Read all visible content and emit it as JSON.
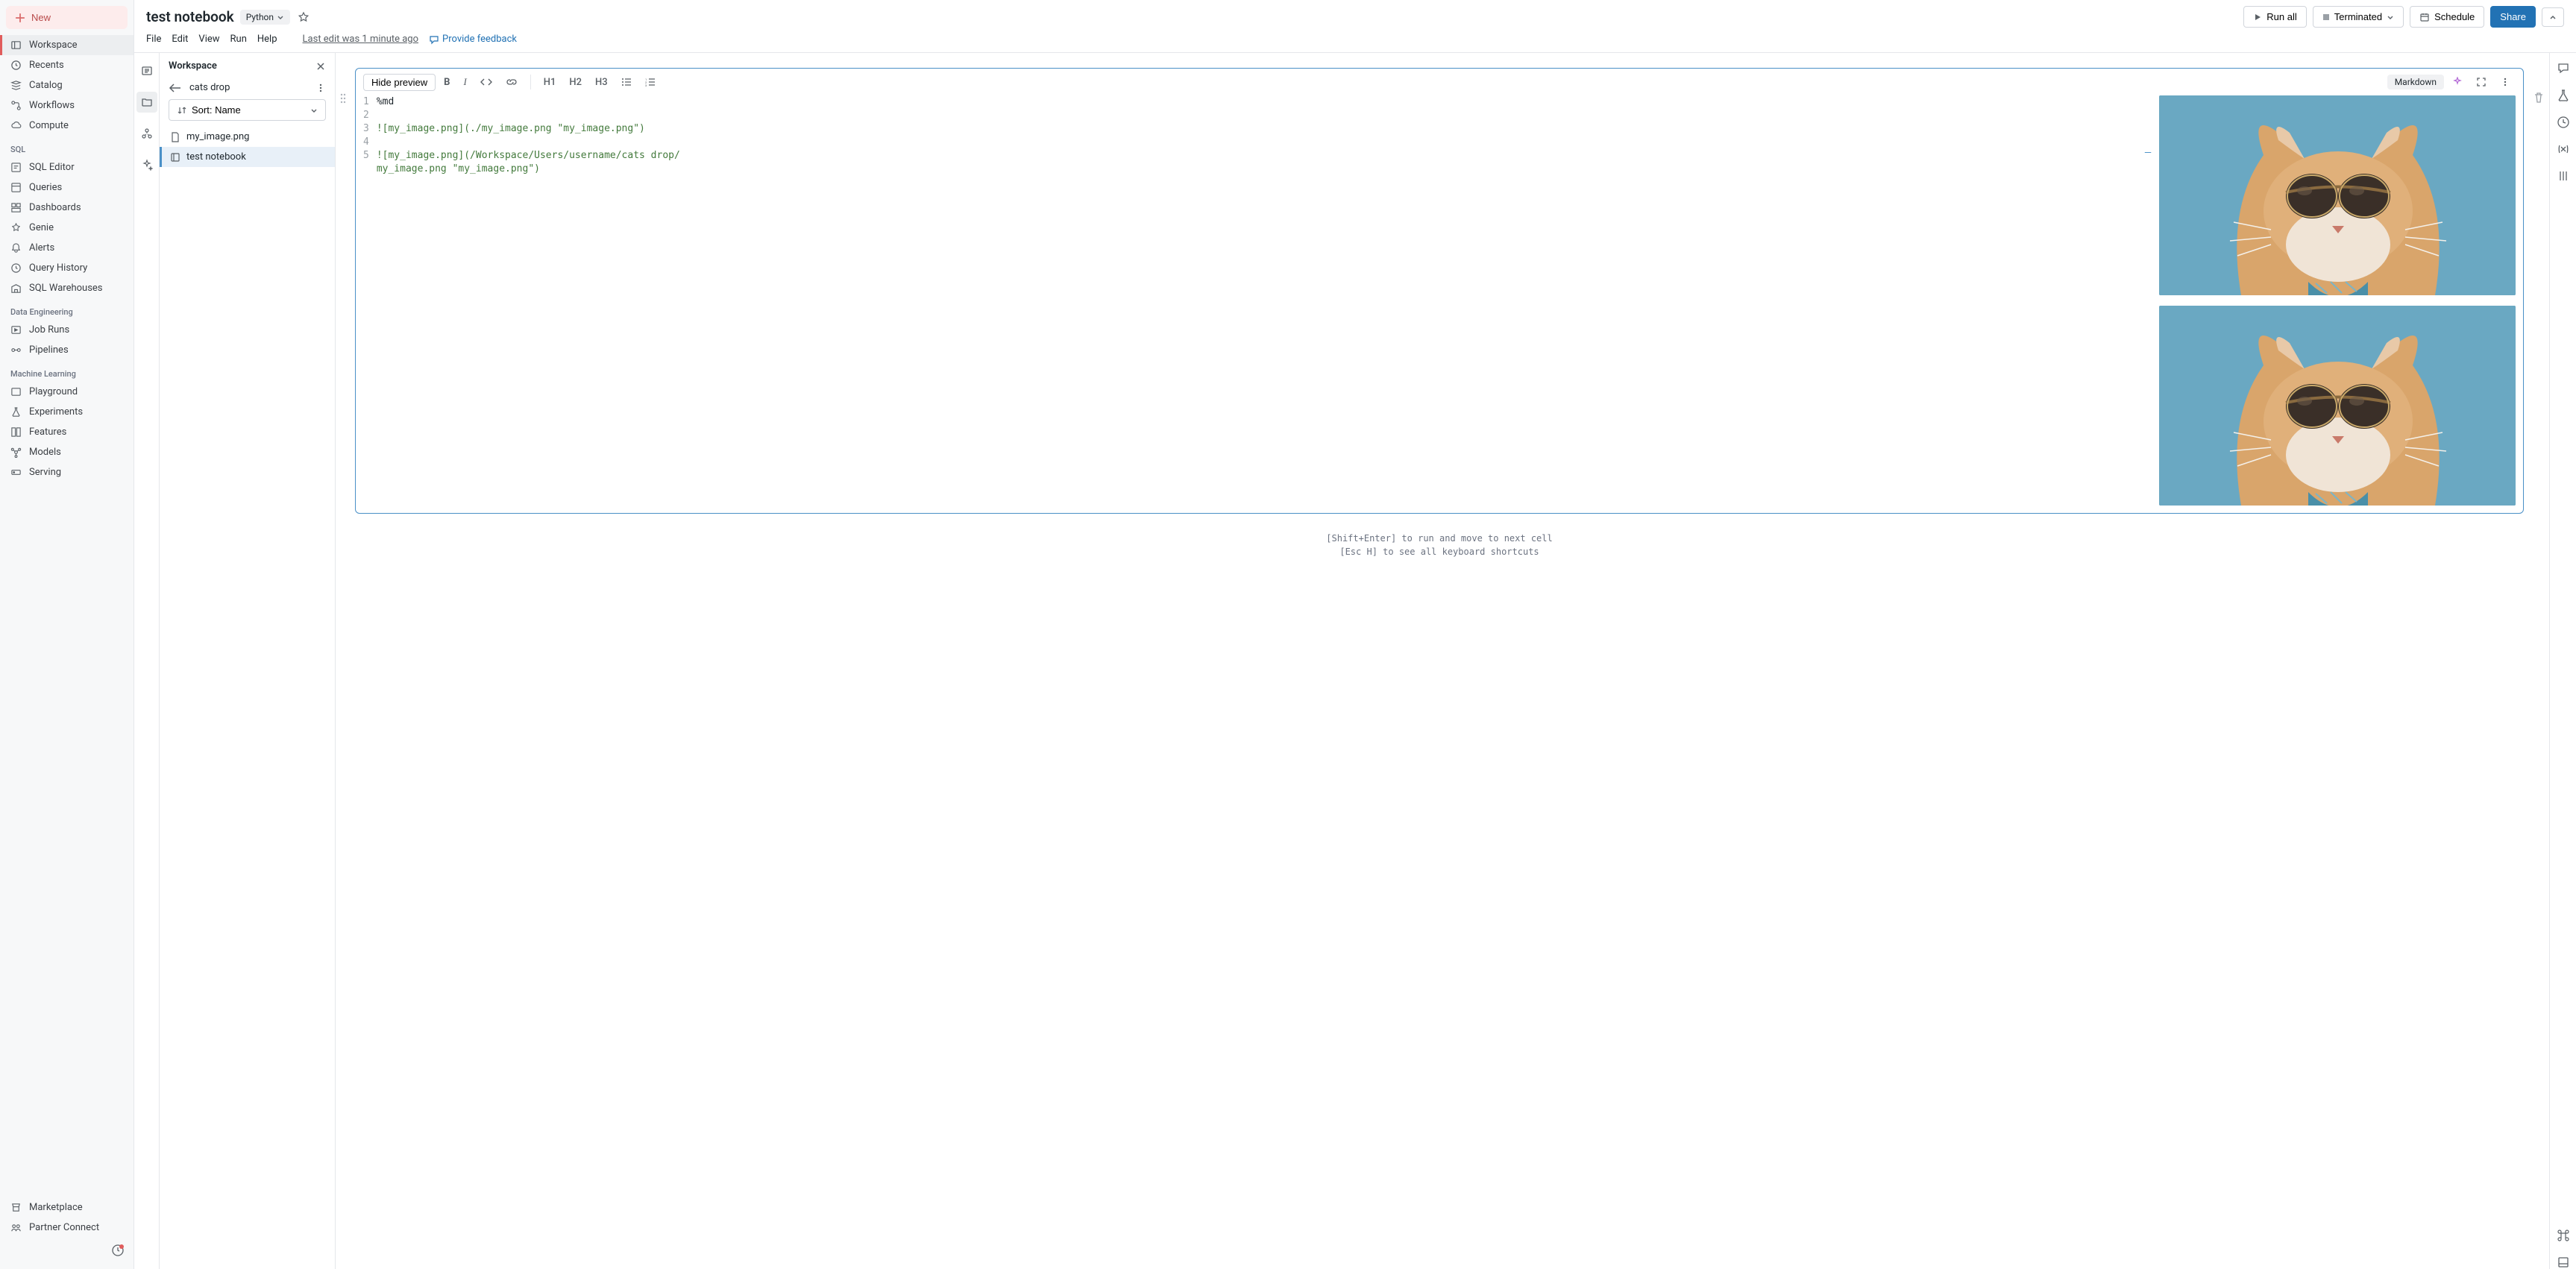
{
  "sidebar": {
    "new_label": "New",
    "nav1": [
      {
        "label": "Workspace",
        "icon": "folder-tree"
      },
      {
        "label": "Recents",
        "icon": "clock"
      },
      {
        "label": "Catalog",
        "icon": "stack"
      },
      {
        "label": "Workflows",
        "icon": "flow"
      },
      {
        "label": "Compute",
        "icon": "cloud"
      }
    ],
    "sql_header": "SQL",
    "nav_sql": [
      {
        "label": "SQL Editor"
      },
      {
        "label": "Queries"
      },
      {
        "label": "Dashboards"
      },
      {
        "label": "Genie"
      },
      {
        "label": "Alerts"
      },
      {
        "label": "Query History"
      },
      {
        "label": "SQL Warehouses"
      }
    ],
    "de_header": "Data Engineering",
    "nav_de": [
      {
        "label": "Job Runs"
      },
      {
        "label": "Pipelines"
      }
    ],
    "ml_header": "Machine Learning",
    "nav_ml": [
      {
        "label": "Playground"
      },
      {
        "label": "Experiments"
      },
      {
        "label": "Features"
      },
      {
        "label": "Models"
      },
      {
        "label": "Serving"
      }
    ],
    "nav_bottom": [
      {
        "label": "Marketplace"
      },
      {
        "label": "Partner Connect"
      }
    ]
  },
  "header": {
    "title": "test notebook",
    "language": "Python",
    "run_all": "Run all",
    "status": "Terminated",
    "schedule": "Schedule",
    "share": "Share"
  },
  "menubar": {
    "file": "File",
    "edit": "Edit",
    "view": "View",
    "run": "Run",
    "help": "Help",
    "last_edit": "Last edit was 1 minute ago",
    "feedback": "Provide feedback"
  },
  "workspace_panel": {
    "title": "Workspace",
    "folder": "cats drop",
    "sort_label": "Sort: Name",
    "files": [
      {
        "name": "my_image.png",
        "type": "file"
      },
      {
        "name": "test notebook",
        "type": "notebook"
      }
    ]
  },
  "cell": {
    "hide_preview": "Hide preview",
    "h1": "H1",
    "h2": "H2",
    "h3": "H3",
    "type_label": "Markdown",
    "lines": [
      "%md",
      "",
      "![my_image.png](./my_image.png \"my_image.png\")",
      "",
      "![my_image.png](/Workspace/Users/username/cats drop/",
      "my_image.png \"my_image.png\")"
    ],
    "line_numbers": [
      "1",
      "2",
      "3",
      "4",
      "5",
      ""
    ]
  },
  "shortcuts": {
    "l1": "[Shift+Enter] to run and move to next cell",
    "l2": "[Esc H] to see all keyboard shortcuts"
  }
}
